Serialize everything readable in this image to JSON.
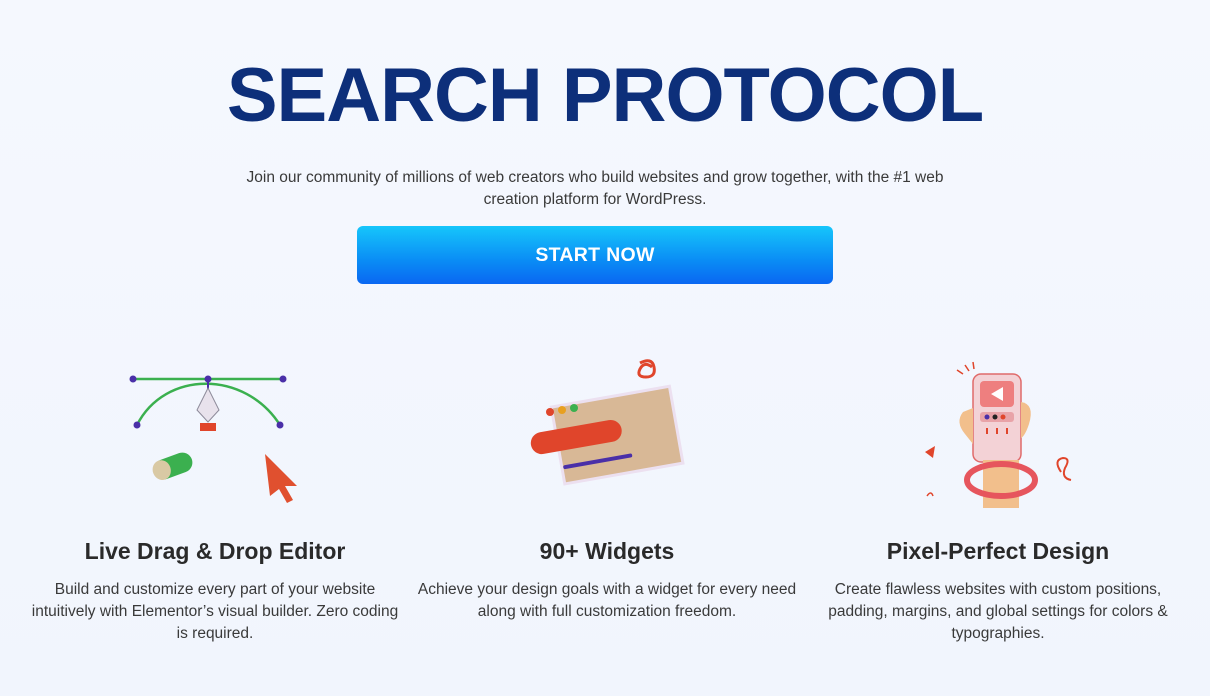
{
  "hero": {
    "title": "SEARCH PROTOCOL",
    "subtitle": "Join our community of millions of web creators who build websites and grow together, with the #1 web creation platform for WordPress.",
    "cta_label": "START NOW"
  },
  "features": [
    {
      "icon": "pen-tool-bezier-icon",
      "title": "Live Drag & Drop Editor",
      "description": "Build and customize every part of your website intuitively with Elementor’s visual builder. Zero coding is required."
    },
    {
      "icon": "widgets-card-icon",
      "title": "90+ Widgets",
      "description": "Achieve your design goals with a widget for every need along with full customization freedom."
    },
    {
      "icon": "phone-in-hand-icon",
      "title": "Pixel-Perfect Design",
      "description": "Create flawless websites with custom positions, padding, margins, and global settings for colors & typographies."
    }
  ],
  "colors": {
    "title": "#0d2f7a",
    "cta_start": "#16c6fb",
    "cta_end": "#0a67f2",
    "background": "#f3f6fd"
  }
}
